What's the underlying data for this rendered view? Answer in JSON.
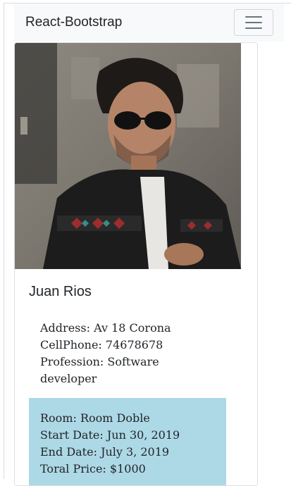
{
  "navbar": {
    "brand": "React-Bootstrap",
    "toggler_icon": "hamburger-menu-icon"
  },
  "profile": {
    "photo": "profile-photo",
    "name": "Juan Rios",
    "address_label": "Address:",
    "address_value": "Av 18 Corona",
    "cellphone_label": "CellPhone:",
    "cellphone_value": "74678678",
    "profession_label": "Profession:",
    "profession_value": "Software developer"
  },
  "booking": {
    "background_color": "#add8e6",
    "room_label": "Room:",
    "room_value": "Room Doble",
    "start_label": "Start Date:",
    "start_value": "Jun 30, 2019",
    "end_label": "End Date:",
    "end_value": "July 3, 2019",
    "price_label": "Toral Price:",
    "price_value": "$1000"
  }
}
